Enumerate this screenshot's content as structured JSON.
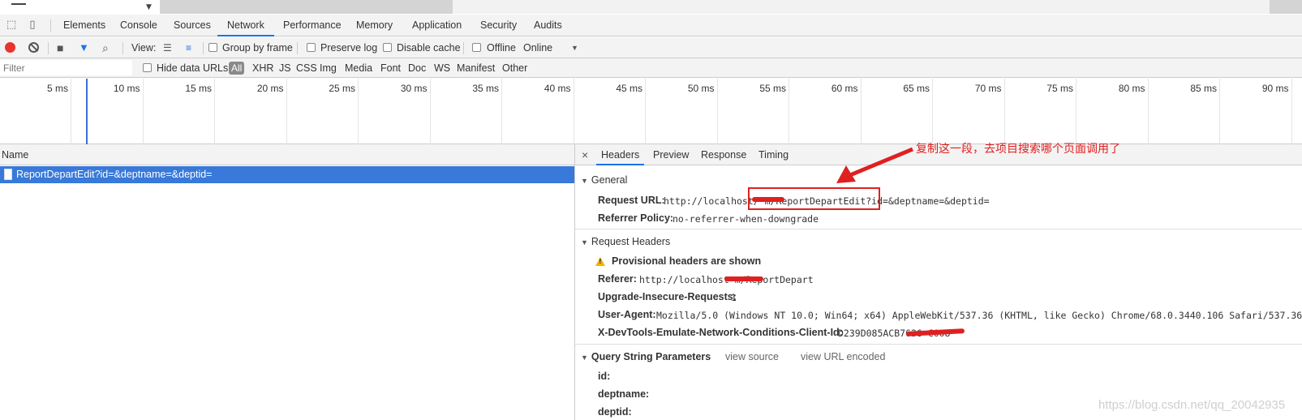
{
  "devtools": {
    "main_tabs": [
      "Elements",
      "Console",
      "Sources",
      "Network",
      "Performance",
      "Memory",
      "Application",
      "Security",
      "Audits"
    ],
    "active_tab": "Network"
  },
  "toolbar": {
    "view_label": "View:",
    "group_by_frame": "Group by frame",
    "preserve_log": "Preserve log",
    "disable_cache": "Disable cache",
    "offline": "Offline",
    "throttle": "Online"
  },
  "filterbar": {
    "filter_placeholder": "Filter",
    "hide_data_urls": "Hide data URLs",
    "types": [
      "All",
      "XHR",
      "JS",
      "CSS",
      "Img",
      "Media",
      "Font",
      "Doc",
      "WS",
      "Manifest",
      "Other"
    ]
  },
  "timeline": {
    "ticks": [
      "5 ms",
      "10 ms",
      "15 ms",
      "20 ms",
      "25 ms",
      "30 ms",
      "35 ms",
      "40 ms",
      "45 ms",
      "50 ms",
      "55 ms",
      "60 ms",
      "65 ms",
      "70 ms",
      "75 ms",
      "80 ms",
      "85 ms",
      "90 ms"
    ]
  },
  "request_list": {
    "header": "Name",
    "rows": [
      "ReportDepartEdit?id=&deptname=&deptid="
    ]
  },
  "details": {
    "tabs": [
      "Headers",
      "Preview",
      "Response",
      "Timing"
    ],
    "close": "×",
    "general": {
      "title": "General",
      "request_url_key": "Request URL:",
      "request_url_value": "http://localhost/     m/ReportDepartEdit?id=&deptname=&deptid=",
      "referrer_policy_key": "Referrer Policy:",
      "referrer_policy_value": "no-referrer-when-downgrade"
    },
    "request_headers": {
      "title": "Request Headers",
      "provisional": "Provisional headers are shown",
      "referer_key": "Referer:",
      "referer_value": "http://localhost     m/ReportDepart",
      "upgrade_key": "Upgrade-Insecure-Requests:",
      "upgrade_value": "1",
      "ua_key": "User-Agent:",
      "ua_value": "Mozilla/5.0 (Windows NT 10.0; Win64; x64) AppleWebKit/537.36 (KHTML, like Gecko) Chrome/68.0.3440.106 Safari/537.36",
      "xdev_key": "X-DevTools-Emulate-Network-Conditions-Client-Id:",
      "xdev_value": "D239D085ACB7636          C008"
    },
    "query": {
      "title": "Query String Parameters",
      "view_source": "view source",
      "view_url_encoded": "view URL encoded",
      "params": [
        "id:",
        "deptname:",
        "deptid:"
      ]
    }
  },
  "annotation": {
    "text": "复制这一段，去项目搜索哪个页面调用了",
    "color": "#e02020"
  },
  "watermark": "https://blog.csdn.net/qq_20042935"
}
